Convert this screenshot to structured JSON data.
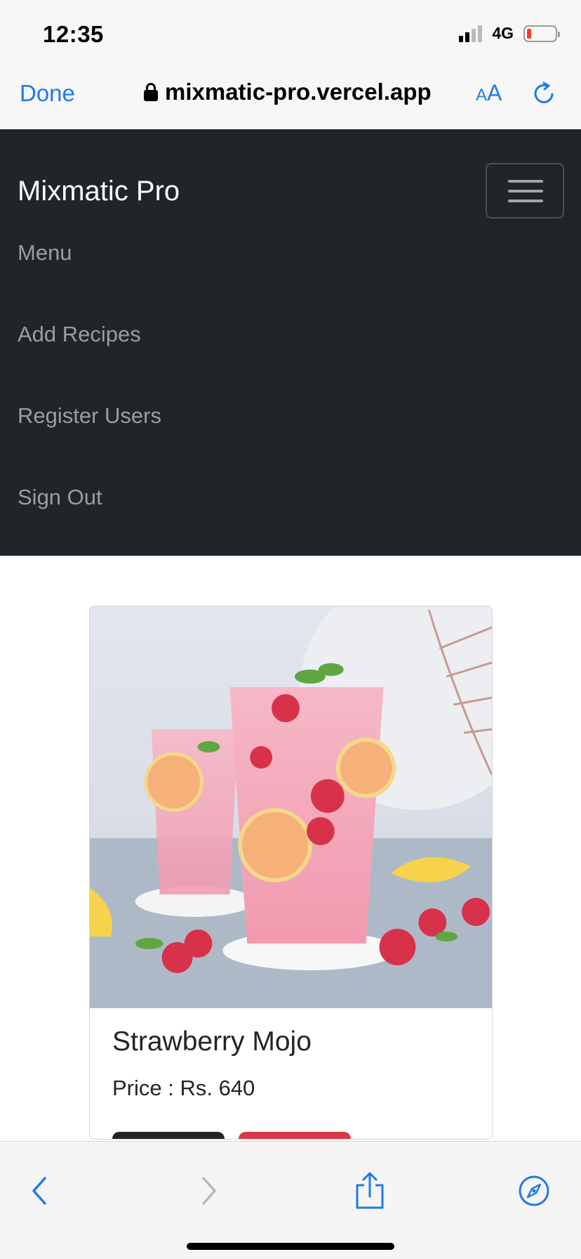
{
  "status_bar": {
    "time": "12:35",
    "network": "4G",
    "signal_bars": 2,
    "signal_bars_total": 4,
    "battery_level": 0.12,
    "battery_color": "#ff3b30"
  },
  "browser": {
    "done_label": "Done",
    "url": "mixmatic-pro.vercel.app",
    "text_size_small": "A",
    "text_size_large": "A",
    "accent_color": "#1f7ae8",
    "lock_icon": "lock-icon",
    "reload_icon": "reload-icon",
    "toolbar_icons": [
      "back-icon",
      "forward-icon",
      "share-icon",
      "compass-icon"
    ]
  },
  "navbar": {
    "brand": "Mixmatic Pro",
    "toggler_icon": "hamburger-icon",
    "background": "#212529",
    "links": [
      {
        "label": "Menu"
      },
      {
        "label": "Add Recipes"
      },
      {
        "label": "Register Users"
      },
      {
        "label": "Sign Out"
      }
    ]
  },
  "card": {
    "title": "Strawberry Mojo",
    "price": "Price : Rs. 640",
    "button_colors": [
      "#212529",
      "#dc3545"
    ]
  }
}
